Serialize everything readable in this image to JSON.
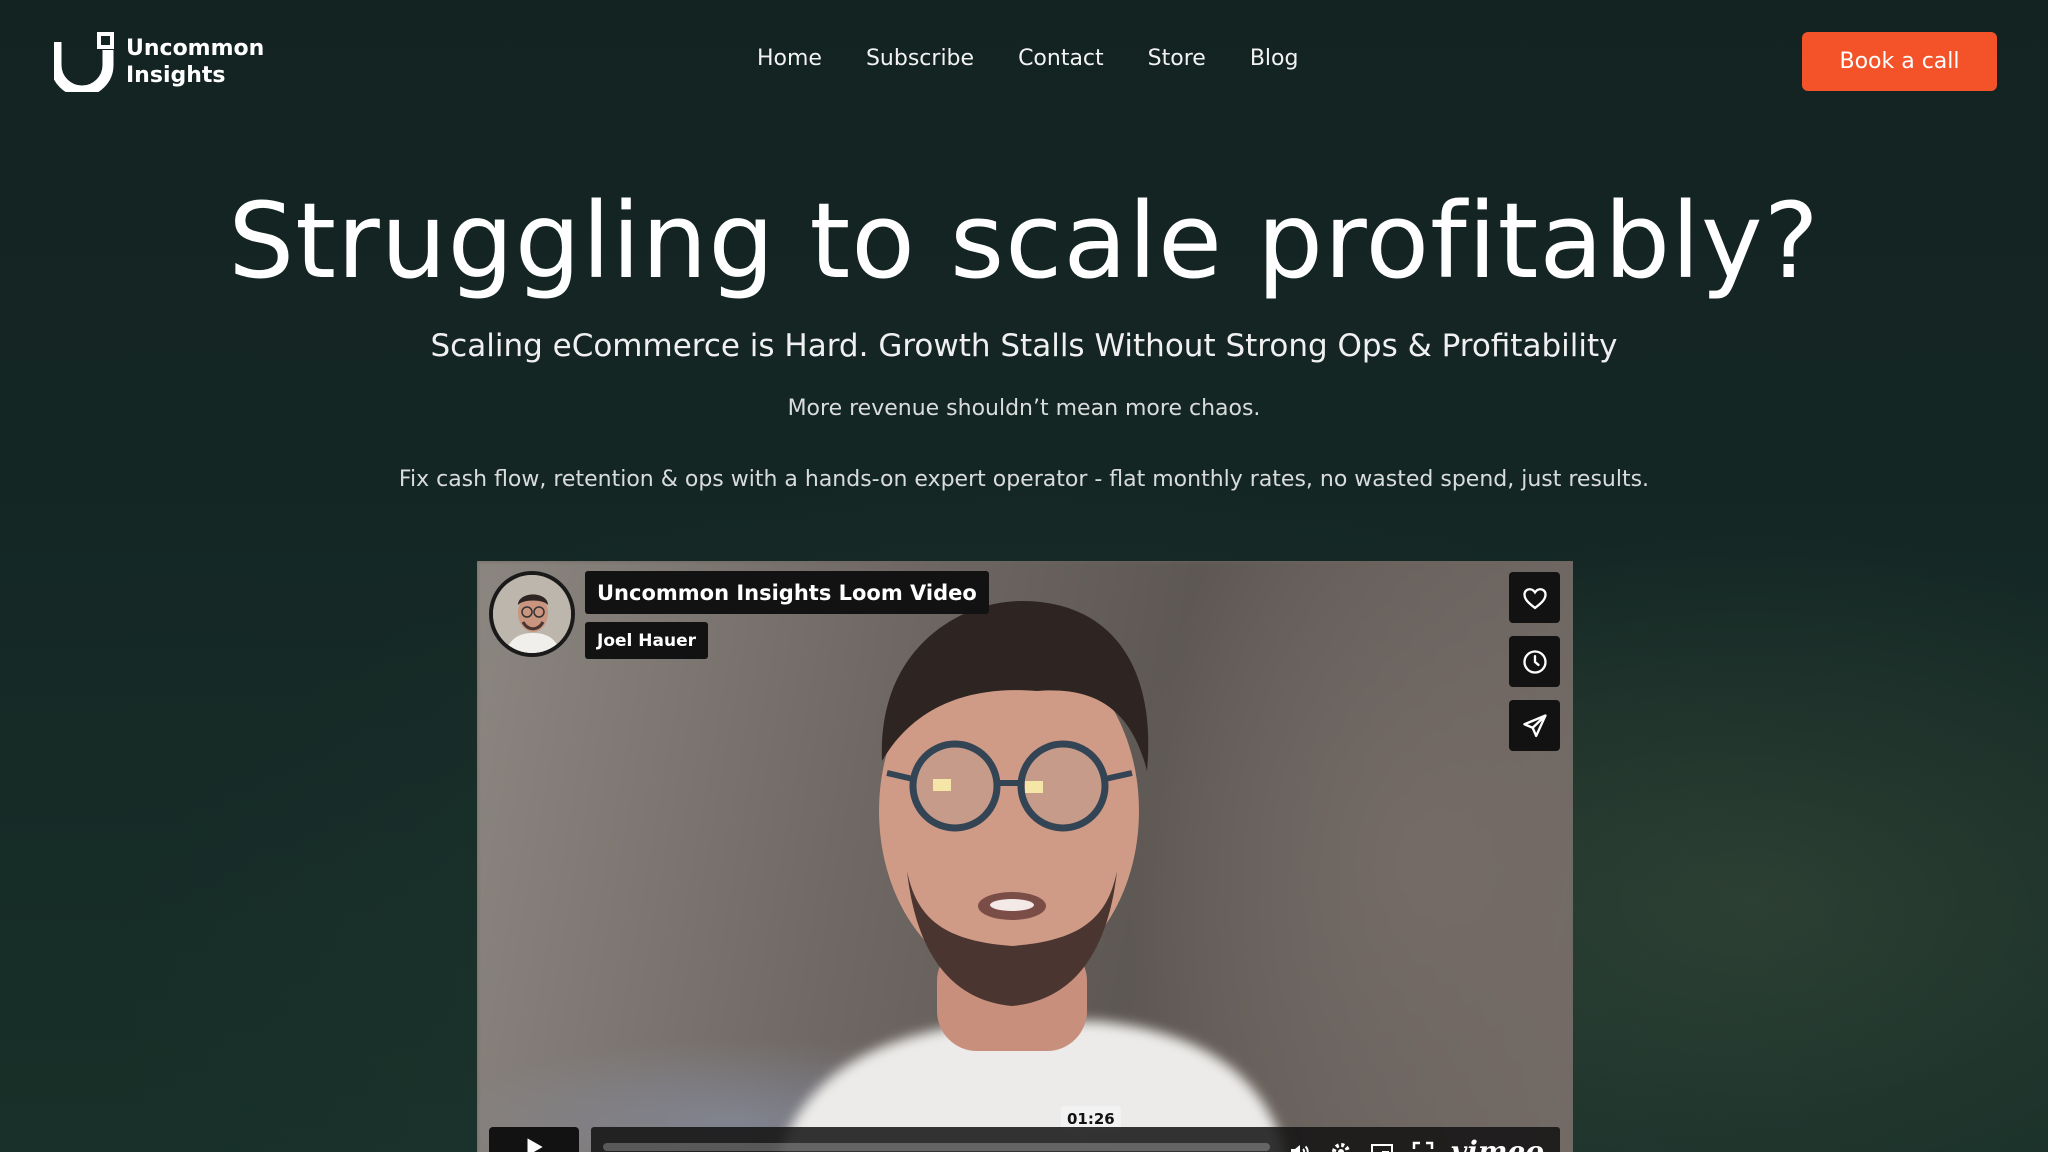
{
  "brand": {
    "name_line1": "Uncommon",
    "name_line2": "Insights"
  },
  "nav": {
    "items": [
      {
        "label": "Home"
      },
      {
        "label": "Subscribe"
      },
      {
        "label": "Contact"
      },
      {
        "label": "Store"
      },
      {
        "label": "Blog"
      }
    ]
  },
  "cta": {
    "label": "Book a call",
    "color": "#f4532a"
  },
  "hero": {
    "heading": "Struggling to scale profitably?",
    "subheading": "Scaling eCommerce is Hard. Growth Stalls Without Strong Ops & Profitability",
    "line1": "More revenue shouldn’t mean more chaos.",
    "line2": "Fix cash flow, retention & ops with a hands-on expert operator - flat monthly rates, no wasted spend, just results."
  },
  "video": {
    "title": "Uncommon Insights Loom Video",
    "author": "Joel Hauer",
    "timecode": "01:26",
    "player_brand": "vimeo",
    "side_buttons": [
      "heart-icon",
      "clock-icon",
      "send-icon"
    ]
  },
  "colors": {
    "background": "#142423",
    "accent": "#f4532a"
  }
}
